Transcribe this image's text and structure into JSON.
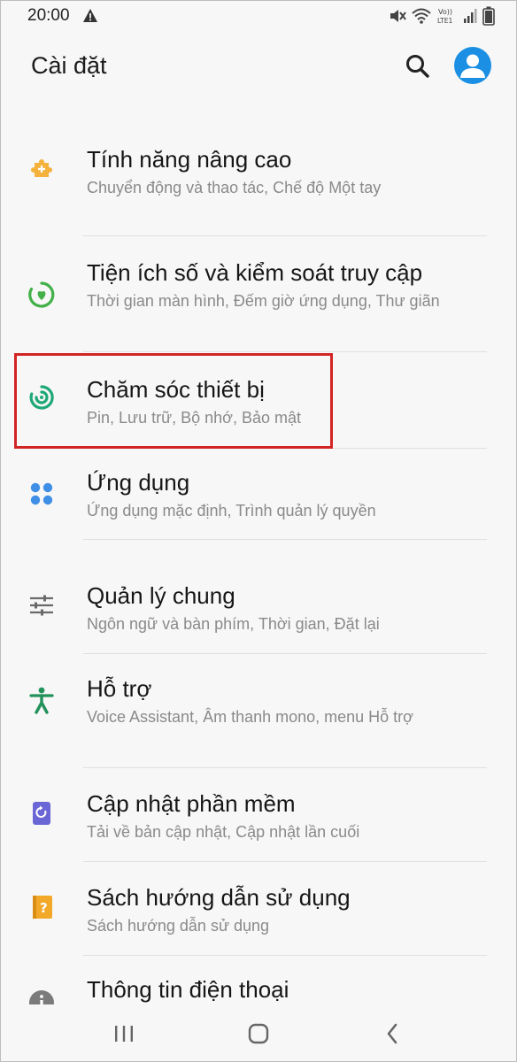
{
  "status_bar": {
    "time": "20:00",
    "network_label": "LTE1"
  },
  "header": {
    "title": "Cài đặt"
  },
  "items": [
    {
      "title": "Tính năng nâng cao",
      "subtitle": "Chuyển động và thao tác, Chế độ Một tay",
      "icon": "puzzle-icon",
      "color": "#f4b23c"
    },
    {
      "title": "Tiện ích số và kiểm soát truy cập",
      "subtitle": "Thời gian màn hình, Đếm giờ ứng dụng, Thư giãn",
      "icon": "digital-wellbeing-icon",
      "color": "#43b04a"
    },
    {
      "title": "Chăm sóc thiết bị",
      "subtitle": "Pin, Lưu trữ, Bộ nhớ, Bảo mật",
      "icon": "device-care-icon",
      "color": "#1fa877"
    },
    {
      "title": "Ứng dụng",
      "subtitle": "Ứng dụng mặc định, Trình quản lý quyền",
      "icon": "apps-icon",
      "color": "#3f8fe6"
    },
    {
      "title": "Quản lý chung",
      "subtitle": "Ngôn ngữ và bàn phím, Thời gian, Đặt lại",
      "icon": "sliders-icon",
      "color": "#6a6a6a"
    },
    {
      "title": "Hỗ trợ",
      "subtitle": "Voice Assistant, Âm thanh mono, menu Hỗ trợ",
      "icon": "accessibility-icon",
      "color": "#22915a"
    },
    {
      "title": "Cập nhật phần mềm",
      "subtitle": "Tải về bản cập nhật, Cập nhật lần cuối",
      "icon": "software-update-icon",
      "color": "#6a66d6"
    },
    {
      "title": "Sách hướng dẫn sử dụng",
      "subtitle": "Sách hướng dẫn sử dụng",
      "icon": "user-manual-icon",
      "color": "#f2a92a"
    },
    {
      "title": "Thông tin điện thoại",
      "subtitle": "",
      "icon": "phone-info-icon",
      "color": "#7b7b7b"
    }
  ],
  "accent": "#1a8fe3",
  "highlight_color": "#d32424"
}
